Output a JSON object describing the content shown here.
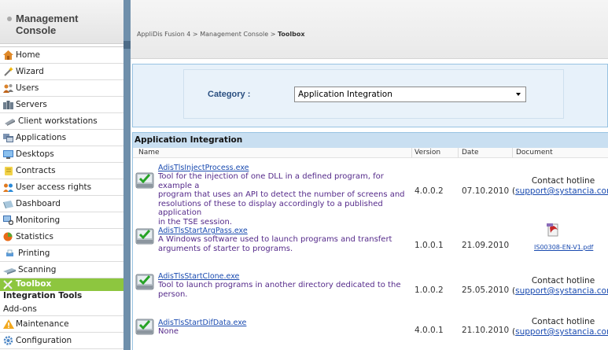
{
  "sidebar": {
    "title_line1": "Management",
    "title_line2": "Console",
    "items": [
      {
        "label": "Home",
        "icon": "home-icon"
      },
      {
        "label": "Wizard",
        "icon": "wand-icon"
      },
      {
        "label": "Users",
        "icon": "users-icon"
      },
      {
        "label": "Servers",
        "icon": "servers-icon"
      },
      {
        "label": "Client workstations",
        "icon": "workstation-icon"
      },
      {
        "label": "Applications",
        "icon": "applications-icon"
      },
      {
        "label": "Desktops",
        "icon": "desktops-icon"
      },
      {
        "label": "Contracts",
        "icon": "contracts-icon"
      },
      {
        "label": "User access rights",
        "icon": "access-rights-icon"
      },
      {
        "label": "Dashboard",
        "icon": "dashboard-icon"
      },
      {
        "label": "Monitoring",
        "icon": "monitoring-icon"
      },
      {
        "label": "Statistics",
        "icon": "statistics-icon"
      },
      {
        "label": "Printing",
        "icon": "printer-icon"
      },
      {
        "label": "Scanning",
        "icon": "scanner-icon"
      },
      {
        "label": "Toolbox",
        "icon": "toolbox-icon"
      }
    ],
    "subitems": [
      "Integration Tools",
      "Add-ons"
    ],
    "bottom_items": [
      {
        "label": "Maintenance",
        "icon": "warning-icon"
      },
      {
        "label": "Configuration",
        "icon": "configuration-icon"
      }
    ]
  },
  "breadcrumb": {
    "part1": "AppliDis Fusion 4",
    "sep": " > ",
    "part2": "Management Console",
    "current": "Toolbox"
  },
  "category": {
    "label": "Category :",
    "selected": "Application Integration"
  },
  "table": {
    "title": "Application Integration",
    "headers": {
      "name": "Name",
      "version": "Version",
      "date": "Date",
      "document": "Document"
    },
    "rows": [
      {
        "name": "AdisTlsInjectProcess.exe",
        "desc_lines": [
          "Tool for the injection of one DLL in a defined program, for example a",
          "program that uses an API to detect the number of screens and",
          "resolutions of these to display accordingly to a published application",
          "in the TSE session."
        ],
        "version": "4.0.0.2",
        "date": "07.10.2010",
        "doc_line1": "Contact hotline",
        "doc_email": "support@systancia.com"
      },
      {
        "name": "AdisTlsStartArgPass.exe",
        "desc_lines": [
          "A Windows software used to launch programs and transfert",
          "arguments of starter to programs."
        ],
        "version": "1.0.0.1",
        "date": "21.09.2010",
        "doc_file": "IS00308-EN-V1.pdf",
        "doc_icon": "pdf-document-icon"
      },
      {
        "name": "AdisTlsStartClone.exe",
        "desc_lines": [
          "Tool to launch programs in another directory dedicated to the",
          "person."
        ],
        "version": "1.0.0.2",
        "date": "25.05.2010",
        "doc_line1": "Contact hotline",
        "doc_email": "support@systancia.com"
      },
      {
        "name": "AdisTlsStartDifData.exe",
        "desc_lines": [
          "None"
        ],
        "version": "4.0.0.1",
        "date": "21.10.2010",
        "doc_line1": "Contact hotline",
        "doc_email": "support@systancia.com"
      }
    ]
  },
  "colors": {
    "active_menu": "#8dc63f",
    "splitter": "#6f8fab",
    "table_title_bg": "#c9dff1",
    "link": "#1a4bb0",
    "description": "#552a8a"
  }
}
